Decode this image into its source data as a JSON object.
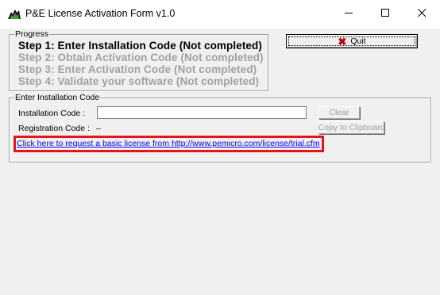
{
  "window": {
    "title": "P&E License Activation Form v1.0",
    "icon": "pe-logo-icon",
    "controls": {
      "minimize": "minimize-icon",
      "maximize": "maximize-icon",
      "close": "close-icon"
    }
  },
  "progress": {
    "legend": "Progress",
    "steps": [
      {
        "label": "Step 1: Enter Installation Code (Not completed)",
        "active": true
      },
      {
        "label": "Step 2: Obtain Activation Code (Not completed)",
        "active": false
      },
      {
        "label": "Step 3: Enter Activation Code (Not completed)",
        "active": false
      },
      {
        "label": "Step 4: Validate your software (Not completed)",
        "active": false
      }
    ]
  },
  "quit_button": {
    "label": "Quit",
    "icon": "x-icon",
    "icon_color": "#c00000"
  },
  "install_group": {
    "legend": "Enter Installation Code",
    "installation_code_label": "Installation Code :",
    "installation_code_value": "",
    "registration_code_label": "Registration Code :",
    "registration_code_value": "–",
    "clear_label": "Clear",
    "copy_label": "Copy to Clipboard",
    "link_text": "Click here to request a basic license from http://www.pemicro.com/license/trial.cfm"
  },
  "colors": {
    "link": "#0000ff",
    "highlight": "#e8121a",
    "disabled_text": "#a0a0a0"
  }
}
